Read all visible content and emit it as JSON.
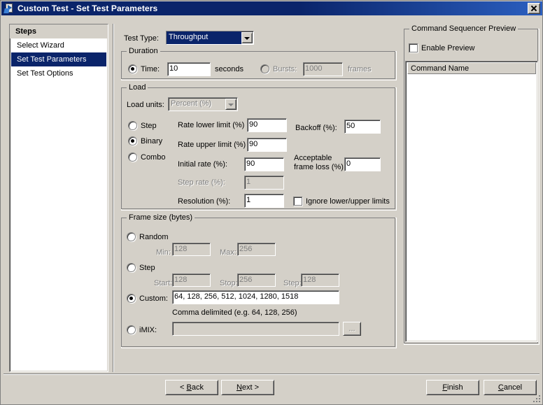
{
  "window": {
    "title": "Custom Test - Set Test Parameters",
    "icon": "wizard-icon",
    "close_label": "X"
  },
  "steps": {
    "header": "Steps",
    "items": [
      {
        "label": "Select Wizard",
        "active": false
      },
      {
        "label": "Set Test Parameters",
        "active": true
      },
      {
        "label": "Set Test Options",
        "active": false
      }
    ]
  },
  "test_type": {
    "label": "Test Type:",
    "value": "Throughput"
  },
  "duration": {
    "legend": "Duration",
    "time_radio": "Time:",
    "time_value": "10",
    "time_units": "seconds",
    "bursts_radio": "Bursts:",
    "bursts_value": "1000",
    "bursts_units": "frames"
  },
  "load": {
    "legend": "Load",
    "units_label": "Load units:",
    "units_value": "Percent (%)",
    "mode_step": "Step",
    "mode_binary": "Binary",
    "mode_combo": "Combo",
    "rate_lower_label": "Rate lower limit (%)",
    "rate_lower_value": "90",
    "rate_upper_label": "Rate upper limit (%)",
    "rate_upper_value": "90",
    "initial_rate_label": "Initial rate (%):",
    "initial_rate_value": "90",
    "step_rate_label": "Step rate (%):",
    "step_rate_value": "1",
    "resolution_label": "Resolution (%):",
    "resolution_value": "1",
    "backoff_label": "Backoff (%):",
    "backoff_value": "50",
    "acceptable_loss_label_1": "Acceptable",
    "acceptable_loss_label_2": "frame loss (%)",
    "acceptable_loss_value": "0",
    "ignore_limits_label": "Ignore lower/upper limits"
  },
  "frame_size": {
    "legend": "Frame size (bytes)",
    "random_label": "Random",
    "random_min_label": "Min:",
    "random_min_value": "128",
    "random_max_label": "Max:",
    "random_max_value": "256",
    "step_label": "Step",
    "step_start_label": "Start:",
    "step_start_value": "128",
    "step_stop_label": "Stop:",
    "step_stop_value": "256",
    "step_step_label": "Step:",
    "step_step_value": "128",
    "custom_label": "Custom:",
    "custom_value": "64, 128, 256, 512, 1024, 1280, 1518",
    "custom_hint": "Comma delimited (e.g. 64, 128, 256)",
    "imix_label": "iMIX:",
    "imix_value": "",
    "imix_browse": "..."
  },
  "preview": {
    "legend": "Command Sequencer Preview",
    "enable_label": "Enable Preview",
    "column_header": "Command Name",
    "rows": []
  },
  "footer": {
    "back": "< Back",
    "back_accel": "B",
    "next": "Next >",
    "next_accel": "N",
    "finish": "Finish",
    "finish_accel": "F",
    "cancel": "Cancel",
    "cancel_accel": "C"
  },
  "colors": {
    "dialog_face": "#d4d0c8",
    "title_active": "#0a246a",
    "selection": "#0a246a",
    "field_bg": "#ffffff",
    "disabled_text": "#808080"
  }
}
